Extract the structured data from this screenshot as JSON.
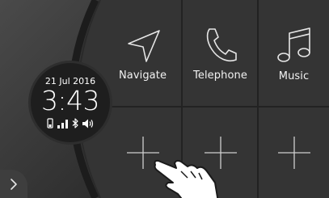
{
  "clock": {
    "date": "21 Jul 2016",
    "time": "3:43",
    "status_icons": [
      "phone-battery-icon",
      "signal-strength-icon",
      "bluetooth-icon",
      "volume-icon"
    ]
  },
  "tiles": [
    {
      "label": "Navigate",
      "icon": "navigation-arrow-icon"
    },
    {
      "label": "Telephone",
      "icon": "telephone-handset-icon"
    },
    {
      "label": "Music",
      "icon": "music-note-icon"
    },
    {
      "label": "",
      "icon": "plus-icon"
    },
    {
      "label": "",
      "icon": "plus-icon"
    },
    {
      "label": "",
      "icon": "plus-icon"
    }
  ],
  "colors": {
    "background": "#2a2a2a",
    "tile_background": "#343434",
    "grid_lines": "#222222",
    "icon_stroke": "#e6e6e6",
    "text": "#ffffff"
  }
}
